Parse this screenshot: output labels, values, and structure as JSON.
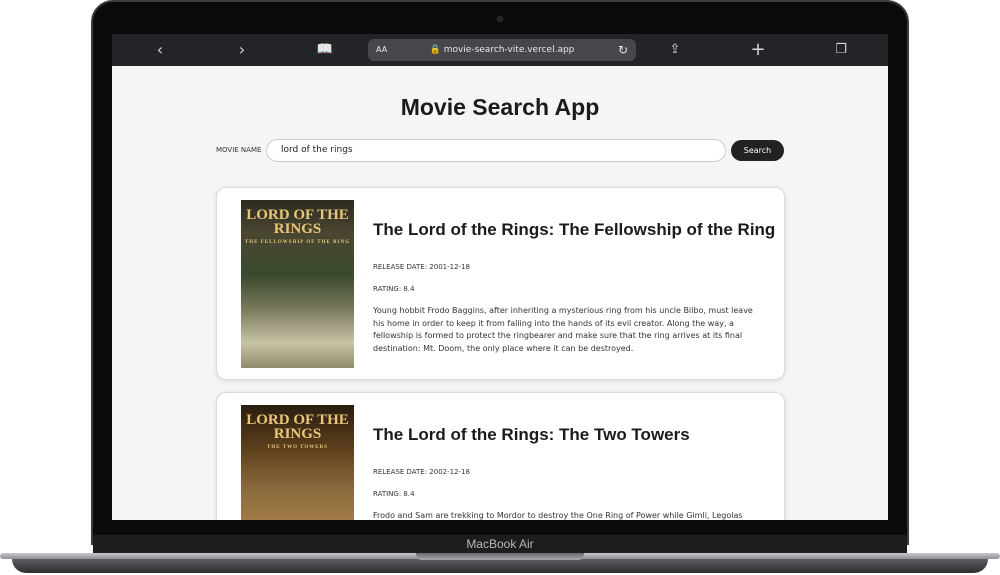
{
  "device": {
    "label": "MacBook Air"
  },
  "browser": {
    "url": "movie-search-vite.vercel.app",
    "text_size_label": "AA"
  },
  "app": {
    "title": "Movie Search App",
    "search": {
      "label": "MOVIE NAME",
      "value": "lord of the rings",
      "button": "Search"
    },
    "movies": [
      {
        "title": "The Lord of the Rings: The Fellowship of the Ring",
        "release": "RELEASE DATE: 2001-12-18",
        "rating": "RATING: 8.4",
        "overview": "Young hobbit Frodo Baggins, after inheriting a mysterious ring from his uncle Bilbo, must leave his home in order to keep it from falling into the hands of its evil creator. Along the way, a fellowship is formed to protect the ringbearer and make sure that the ring arrives at its final destination: Mt. Doom, the only place where it can be destroyed.",
        "poster_title": "LORD OF THE RINGS",
        "poster_sub": "THE FELLOWSHIP OF THE RING"
      },
      {
        "title": "The Lord of the Rings: The Two Towers",
        "release": "RELEASE DATE: 2002-12-18",
        "rating": "RATING: 8.4",
        "overview": "Frodo and Sam are trekking to Mordor to destroy the One Ring of Power while Gimli, Legolas",
        "poster_title": "LORD OF THE RINGS",
        "poster_sub": "THE TWO TOWERS"
      }
    ]
  }
}
